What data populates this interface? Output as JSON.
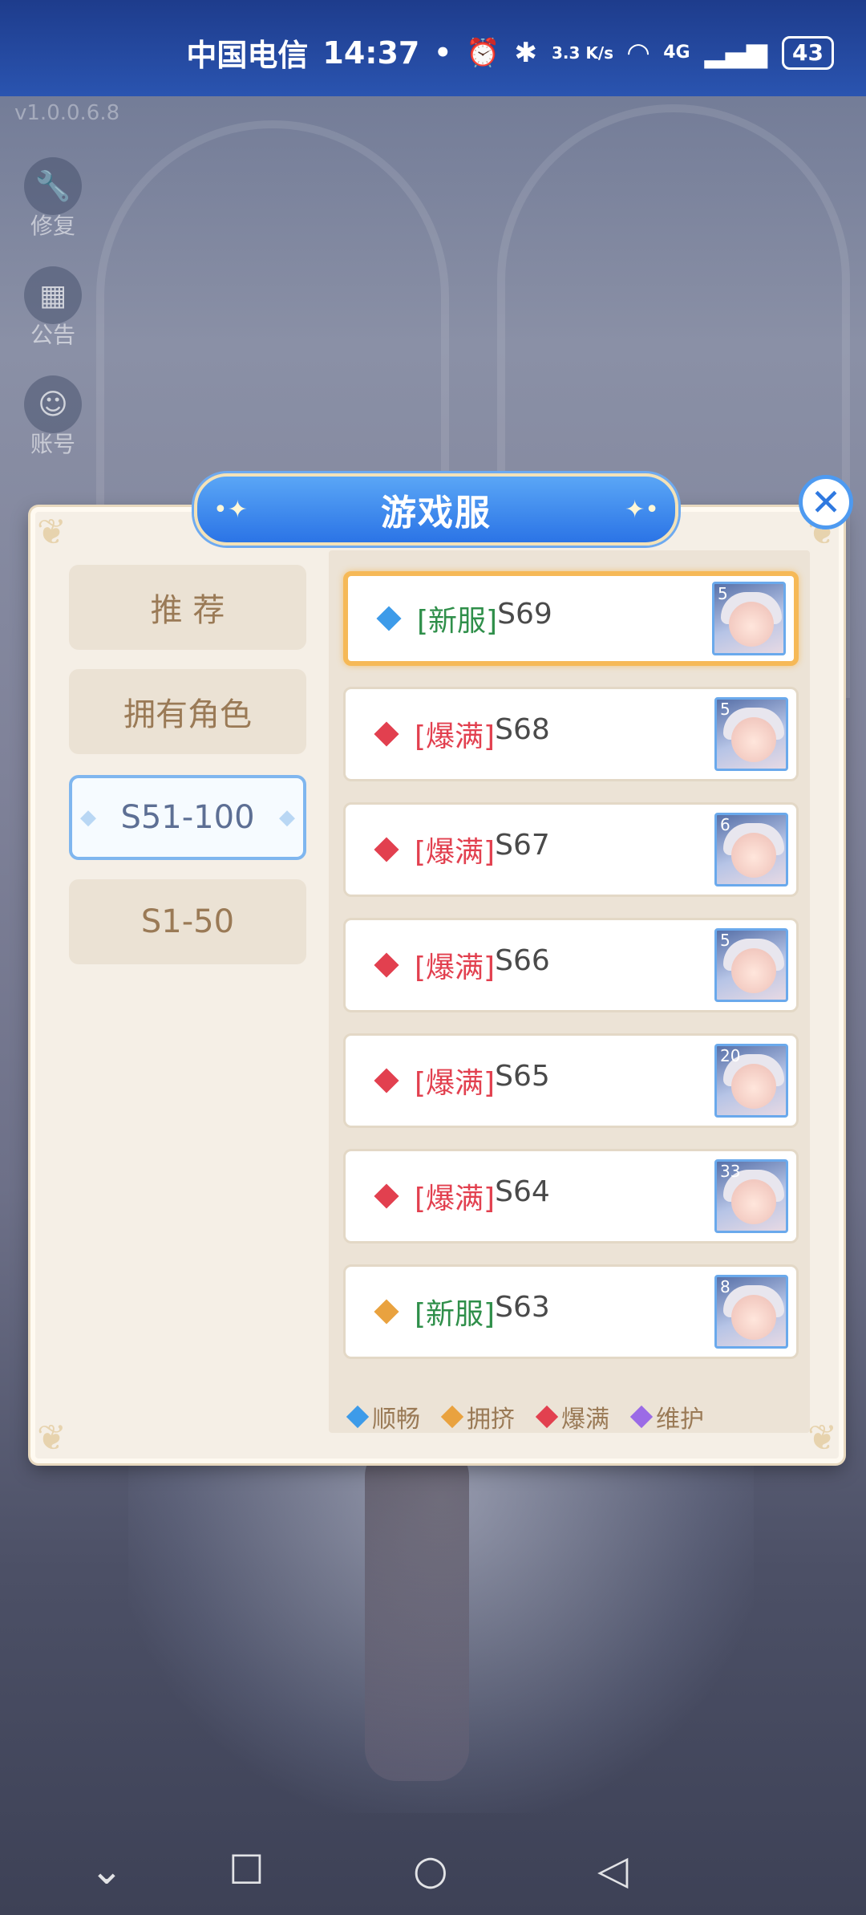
{
  "status_bar": {
    "carrier": "中国电信",
    "time": "14:37",
    "net_speed": "3.3 K/s",
    "network": "4G",
    "battery": "43"
  },
  "version": "v1.0.0.6.8",
  "side_buttons": [
    {
      "label": "修复",
      "icon": "wrench-icon"
    },
    {
      "label": "公告",
      "icon": "calendar-icon"
    },
    {
      "label": "账号",
      "icon": "avatar-icon"
    }
  ],
  "dialog": {
    "title": "游戏服",
    "tabs": [
      "推 荐",
      "拥有角色",
      "S51-100",
      "S1-50"
    ],
    "active_tab": "S51-100",
    "servers": [
      {
        "tag": "[新服]",
        "name": "S69",
        "status": "顺畅",
        "color": "#3d9be9",
        "count": "5",
        "selected": true
      },
      {
        "tag": "[爆满]",
        "name": "S68",
        "status": "爆满",
        "color": "#e2404f",
        "count": "5",
        "selected": false
      },
      {
        "tag": "[爆满]",
        "name": "S67",
        "status": "爆满",
        "color": "#e2404f",
        "count": "6",
        "selected": false
      },
      {
        "tag": "[爆满]",
        "name": "S66",
        "status": "爆满",
        "color": "#e2404f",
        "count": "5",
        "selected": false
      },
      {
        "tag": "[爆满]",
        "name": "S65",
        "status": "爆满",
        "color": "#e2404f",
        "count": "20",
        "selected": false
      },
      {
        "tag": "[爆满]",
        "name": "S64",
        "status": "爆满",
        "color": "#e2404f",
        "count": "33",
        "selected": false
      },
      {
        "tag": "[新服]",
        "name": "S63",
        "status": "拥挤",
        "color": "#e9a23f",
        "count": "8",
        "selected": false
      }
    ],
    "legend": [
      {
        "label": "顺畅",
        "color": "#3d9be9"
      },
      {
        "label": "拥挤",
        "color": "#e9a23f"
      },
      {
        "label": "爆满",
        "color": "#e2404f"
      },
      {
        "label": "维护",
        "color": "#9b6be6"
      }
    ],
    "colors": {
      "new_tag": "#2f8f4a",
      "full_tag": "#e2404f"
    }
  }
}
